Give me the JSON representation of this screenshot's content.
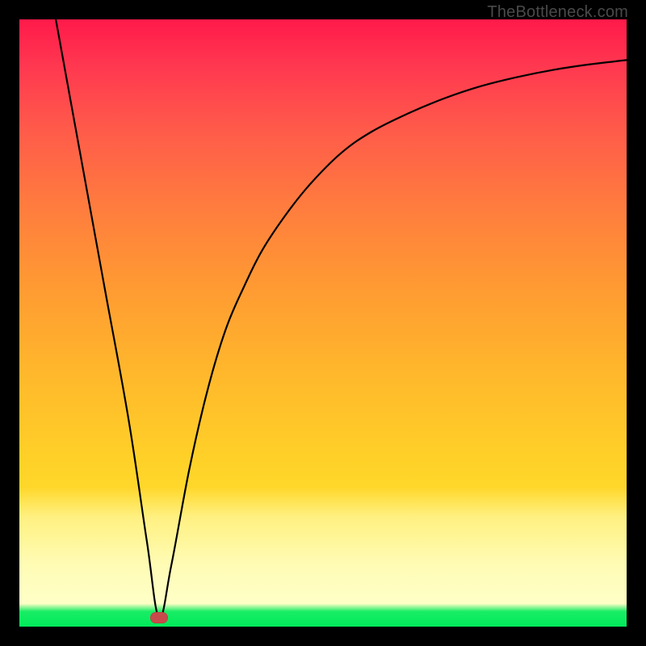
{
  "watermark": "TheBottleneck.com",
  "chart_data": {
    "type": "line",
    "title": "",
    "xlabel": "",
    "ylabel": "",
    "xlim": [
      0,
      100
    ],
    "ylim": [
      0,
      100
    ],
    "grid": false,
    "legend": false,
    "background_gradient": {
      "top": "#ff1a4a",
      "mid": "#ffb52c",
      "low": "#fff06a",
      "bottom": "#00eb5a"
    },
    "marker": {
      "x": 23,
      "y": 1.5,
      "color": "#c84b4b"
    },
    "series": [
      {
        "name": "curve",
        "x": [
          6,
          10,
          14,
          18,
          21,
          23,
          25,
          28,
          31,
          34,
          37,
          40,
          44,
          48,
          53,
          58,
          64,
          70,
          76,
          82,
          88,
          94,
          100
        ],
        "y": [
          100,
          78,
          56,
          34,
          14,
          1.5,
          10,
          26,
          39,
          49,
          56,
          62,
          68,
          73,
          78,
          81.5,
          84.5,
          87,
          89,
          90.5,
          91.7,
          92.6,
          93.3
        ]
      }
    ]
  }
}
